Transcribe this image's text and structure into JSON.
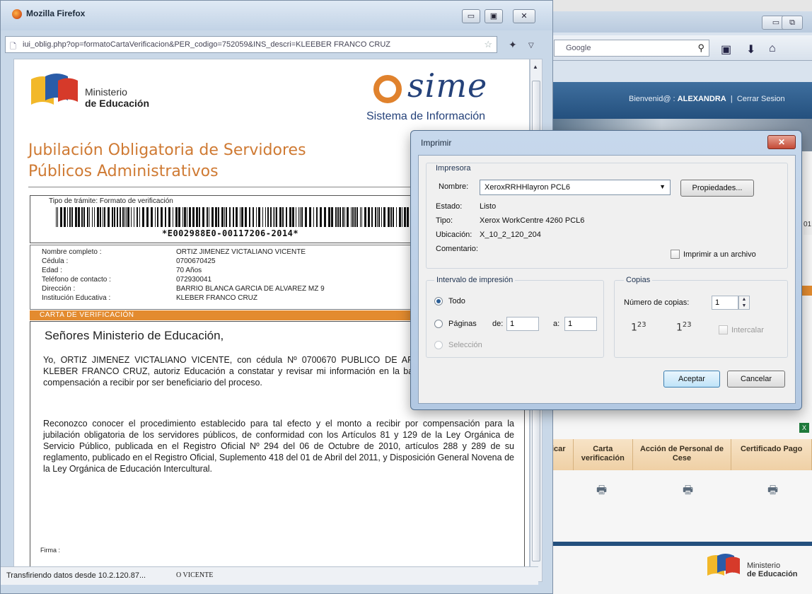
{
  "background_window": {
    "search_placeholder": "Google",
    "welcome_prefix": "Bienvenid@ :",
    "welcome_user": "ALEXANDRA",
    "logout": "Cerrar Sesion",
    "side_fragment": "01",
    "table_headers": [
      "rificar",
      "Carta verificación",
      "Acción de Personal de Cese",
      "Certificado Pago"
    ],
    "footer_logo": {
      "line1": "Ministerio",
      "line2": "de Educación"
    }
  },
  "firefox": {
    "title": "Mozilla Firefox",
    "url": "iui_oblig.php?op=formatoCartaVerificacion&PER_codigo=752059&INS_descri=KLEEBER FRANCO CRUZ",
    "status": "Transfiriendo datos desde 10.2.120.87...",
    "status_sig": "O VICENTE"
  },
  "document": {
    "ministry": {
      "line1": "Ministerio",
      "line2": "de Educación"
    },
    "sime": {
      "brand": "sime",
      "subtitle": "Sistema de Información"
    },
    "title_line1": "Jubilación Obligatoria de Servidores",
    "title_line2": "Públicos Administrativos",
    "tramite": "Tipo de trámite: Formato de verificación",
    "barcode_text": "*E002988E0-00117206-2014*",
    "fields": [
      {
        "label": "Nombre completo :",
        "value": "ORTIZ JIMENEZ VICTALIANO VICENTE"
      },
      {
        "label": "Cédula :",
        "value": "0700670425"
      },
      {
        "label": "Edad :",
        "value": "70 Años"
      },
      {
        "label": "Teléfono de contacto :",
        "value": "072930041"
      },
      {
        "label": "Dirección :",
        "value": "BARRIO BLANCA GARCIA DE ALVAREZ MZ 9"
      },
      {
        "label": "Institución Educativa :",
        "value": "KLEBER FRANCO CRUZ"
      }
    ],
    "section_bar": "CARTA DE VERIFICACIÓN",
    "greeting": "Señores Ministerio de Educación,",
    "paragraph1": "Yo, ORTIZ JIMENEZ VICTALIANO VICENTE, con cédula Nº 0700670 PUBLICO DE APOYO 1 de la Institución KLEBER FRANCO CRUZ, autoriz Educación a constatar y revisar mi información en la base de datos para esta la compensación a recibir por ser beneficiario del proceso.",
    "paragraph2": "Reconozco conocer el procedimiento establecido para tal efecto y el monto a recibir por compensación para la jubilación obligatoria de los servidores públicos, de conformidad con los Artículos 81 y 129 de la Ley Orgánica de Servicio Público, publicada en el Registro Oficial Nº 294 del 06 de Octubre de 2010, artículos 288 y 289 de su reglamento, publicado en el Registro Oficial, Suplemento 418 del 01 de Abril del 2011, y Disposición General Novena de la Ley Orgánica de Educación Intercultural.",
    "firma": "Firma :"
  },
  "print_dialog": {
    "title": "Imprimir",
    "printer_group": "Impresora",
    "name_label": "Nombre:",
    "printer_name": "XeroxRRHHlayron PCL6",
    "properties_button": "Propiedades...",
    "status_label": "Estado:",
    "status_value": "Listo",
    "type_label": "Tipo:",
    "type_value": "Xerox WorkCentre 4260 PCL6",
    "location_label": "Ubicación:",
    "location_value": "X_10_2_120_204",
    "comment_label": "Comentario:",
    "print_to_file": "Imprimir a un archivo",
    "range_group": "Intervalo de impresión",
    "range_all": "Todo",
    "range_pages": "Páginas",
    "from_label": "de:",
    "from_value": "1",
    "to_label": "a:",
    "to_value": "1",
    "range_selection": "Selección",
    "copies_group": "Copias",
    "copies_label": "Número de copias:",
    "copies_value": "1",
    "collate": "Intercalar",
    "ok_button": "Aceptar",
    "cancel_button": "Cancelar",
    "selected_range": "all"
  }
}
